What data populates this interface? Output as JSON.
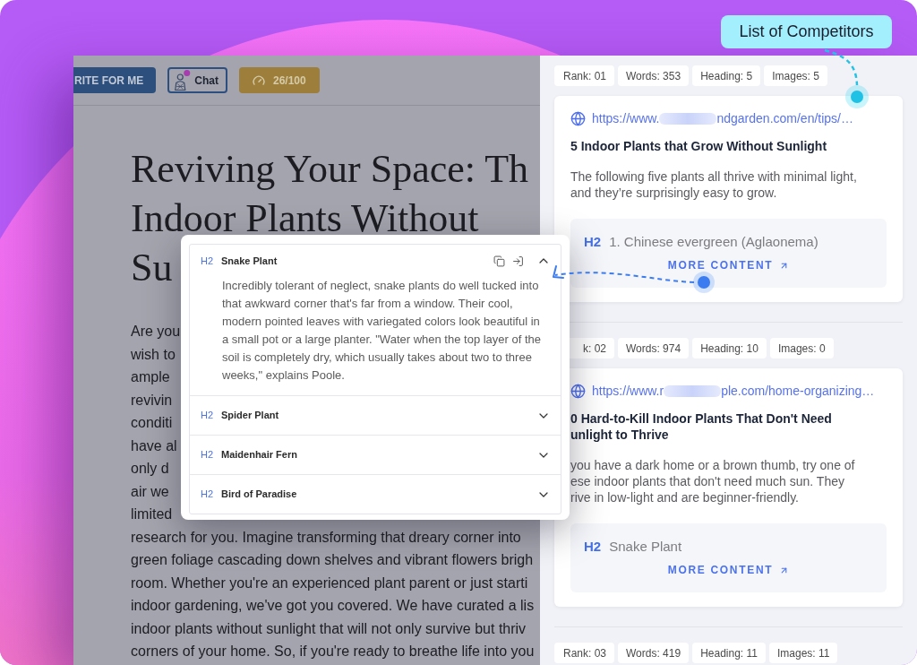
{
  "editor": {
    "toolbar": [
      {
        "kind": "write",
        "label": "RITE FOR ME"
      },
      {
        "kind": "chat",
        "label": "Chat"
      },
      {
        "kind": "score",
        "label": "26/100"
      }
    ],
    "title": {
      "lines": [
        "Reviving Your Space: Th",
        "Indoor Plants Without"
      ],
      "partly_hidden_line": "Su"
    },
    "body": {
      "partly_hidden_lines": [
        "Are you",
        "wish to",
        "ample",
        "revivin",
        "conditi",
        "have al",
        "only d",
        "air we",
        "limited"
      ],
      "lines": [
        "research for you. Imagine transforming that dreary corner into",
        "green foliage cascading down shelves and vibrant flowers brigh",
        "room. Whether you're an experienced plant parent or just starti",
        "indoor gardening, we've got you covered. We have curated a lis",
        "indoor plants without sunlight that will not only survive but thriv",
        "corners of your home. So, if you're ready to breathe life into you"
      ]
    }
  },
  "outline_popup": {
    "sections": [
      {
        "level": "H2",
        "title": "Snake Plant",
        "expanded": true,
        "text": "Incredibly tolerant of neglect, snake plants do well tucked into that awkward corner that's far from a window. Their cool, modern pointed leaves with variegated colors look beautiful in a small pot or a large planter. \"Water when the top layer of the soil is completely dry, which usually takes about two to three weeks,\" explains Poole."
      },
      {
        "level": "H2",
        "title": "Spider Plant",
        "expanded": false
      },
      {
        "level": "H2",
        "title": "Maidenhair Fern",
        "expanded": false
      },
      {
        "level": "H2",
        "title": "Bird of Paradise",
        "expanded": false
      }
    ]
  },
  "competitors": [
    {
      "stats": [
        "Rank: 01",
        "Words: 353",
        "Heading: 5",
        "Images: 5"
      ],
      "url": {
        "visible_start": "https://www.",
        "redacted": true,
        "visible_end": "ndgarden.com/en/tips/…"
      },
      "title_lines": [
        "5 Indoor Plants that Grow Without Sunlight"
      ],
      "snippet_lines": [
        "The following five plants all thrive with minimal light,",
        "and they’re surprisingly easy to grow."
      ],
      "preview": {
        "level": "H2",
        "heading": "1. Chinese evergreen (Aglaonema)",
        "link": "MORE CONTENT"
      }
    },
    {
      "stats": [
        "k: 02",
        "Words: 974",
        "Heading: 10",
        "Images: 0"
      ],
      "url": {
        "visible_start": "https://www.r",
        "redacted": true,
        "visible_end": "ple.com/home-organizing…"
      },
      "title_lines": [
        "0 Hard-to-Kill Indoor Plants That Don't Need",
        "unlight to Thrive"
      ],
      "snippet_lines": [
        "you have a dark home or a brown thumb, try one of",
        "ese indoor plants that don't need much sun. They",
        "rive in low-light and are beginner-friendly."
      ],
      "preview": {
        "level": "H2",
        "heading": "Snake Plant",
        "link": "MORE CONTENT"
      }
    },
    {
      "stats": [
        "Rank: 03",
        "Words: 419",
        "Heading: 11",
        "Images: 11"
      ]
    }
  ],
  "callout": {
    "label": "List of Competitors"
  }
}
